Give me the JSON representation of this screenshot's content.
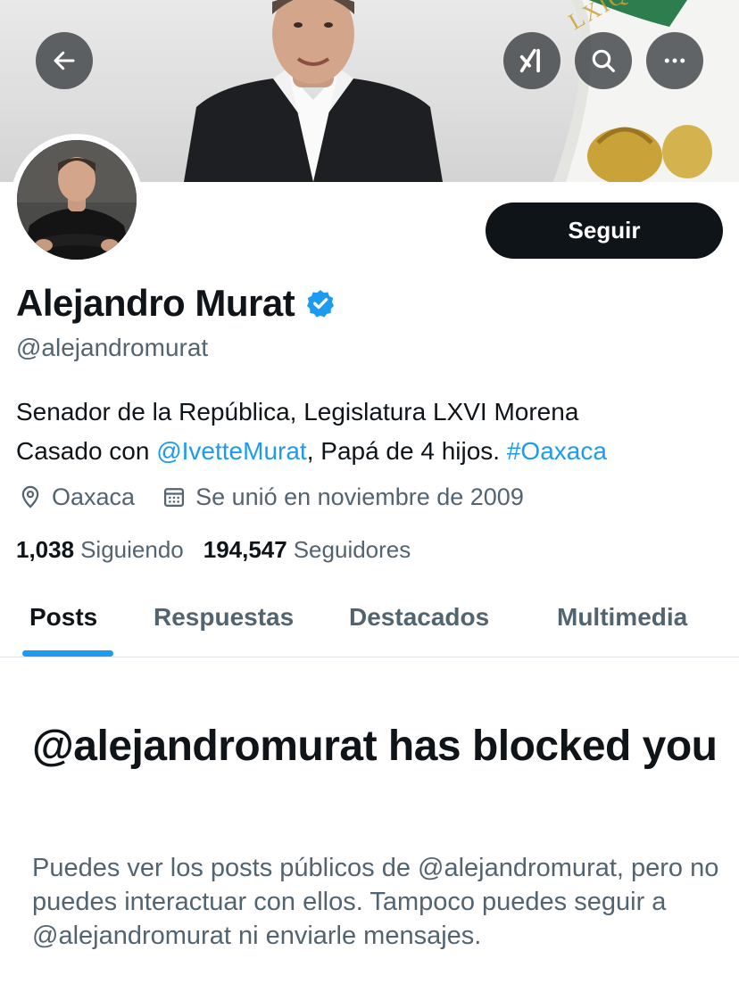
{
  "colors": {
    "accent": "#1d9bf0",
    "text_primary": "#0f1419",
    "text_secondary": "#536471",
    "follow_button_bg": "#0f1419",
    "follow_button_text": "#ffffff",
    "verified_badge": "#1d9bf0"
  },
  "header": {
    "back_icon": "arrow-left-icon",
    "grok_icon": "grok-icon",
    "search_icon": "search-icon",
    "more_icon": "more-horizontal-icon",
    "banner_flag_text": "LXIQNOS"
  },
  "profile": {
    "follow_label": "Seguir",
    "display_name": "Alejandro Murat",
    "verified_icon": "verified-badge-icon",
    "handle": "@alejandromurat",
    "bio": {
      "line1": "Senador de la República, Legislatura LXVI Morena",
      "line2_prefix": "Casado con ",
      "mention": "@IvetteMurat",
      "line2_middle": ", Papá de 4 hijos. ",
      "hashtag": "#Oaxaca"
    },
    "location_icon": "location-pin-icon",
    "location": "Oaxaca",
    "joined_icon": "calendar-icon",
    "joined": "Se unió en noviembre de 2009",
    "following_count": "1,038",
    "following_label": "Siguiendo",
    "followers_count": "194,547",
    "followers_label": "Seguidores"
  },
  "tabs": [
    {
      "label": "Posts",
      "active": true
    },
    {
      "label": "Respuestas",
      "active": false
    },
    {
      "label": "Destacados",
      "active": false
    },
    {
      "label": "Multimedia",
      "active": false
    }
  ],
  "blocked": {
    "title": "@alejandromurat has blocked you",
    "description": "Puedes ver los posts públicos de @alejandromurat, pero no puedes interactuar con ellos. Tampoco puedes seguir a @alejandromurat ni enviarle mensajes."
  }
}
